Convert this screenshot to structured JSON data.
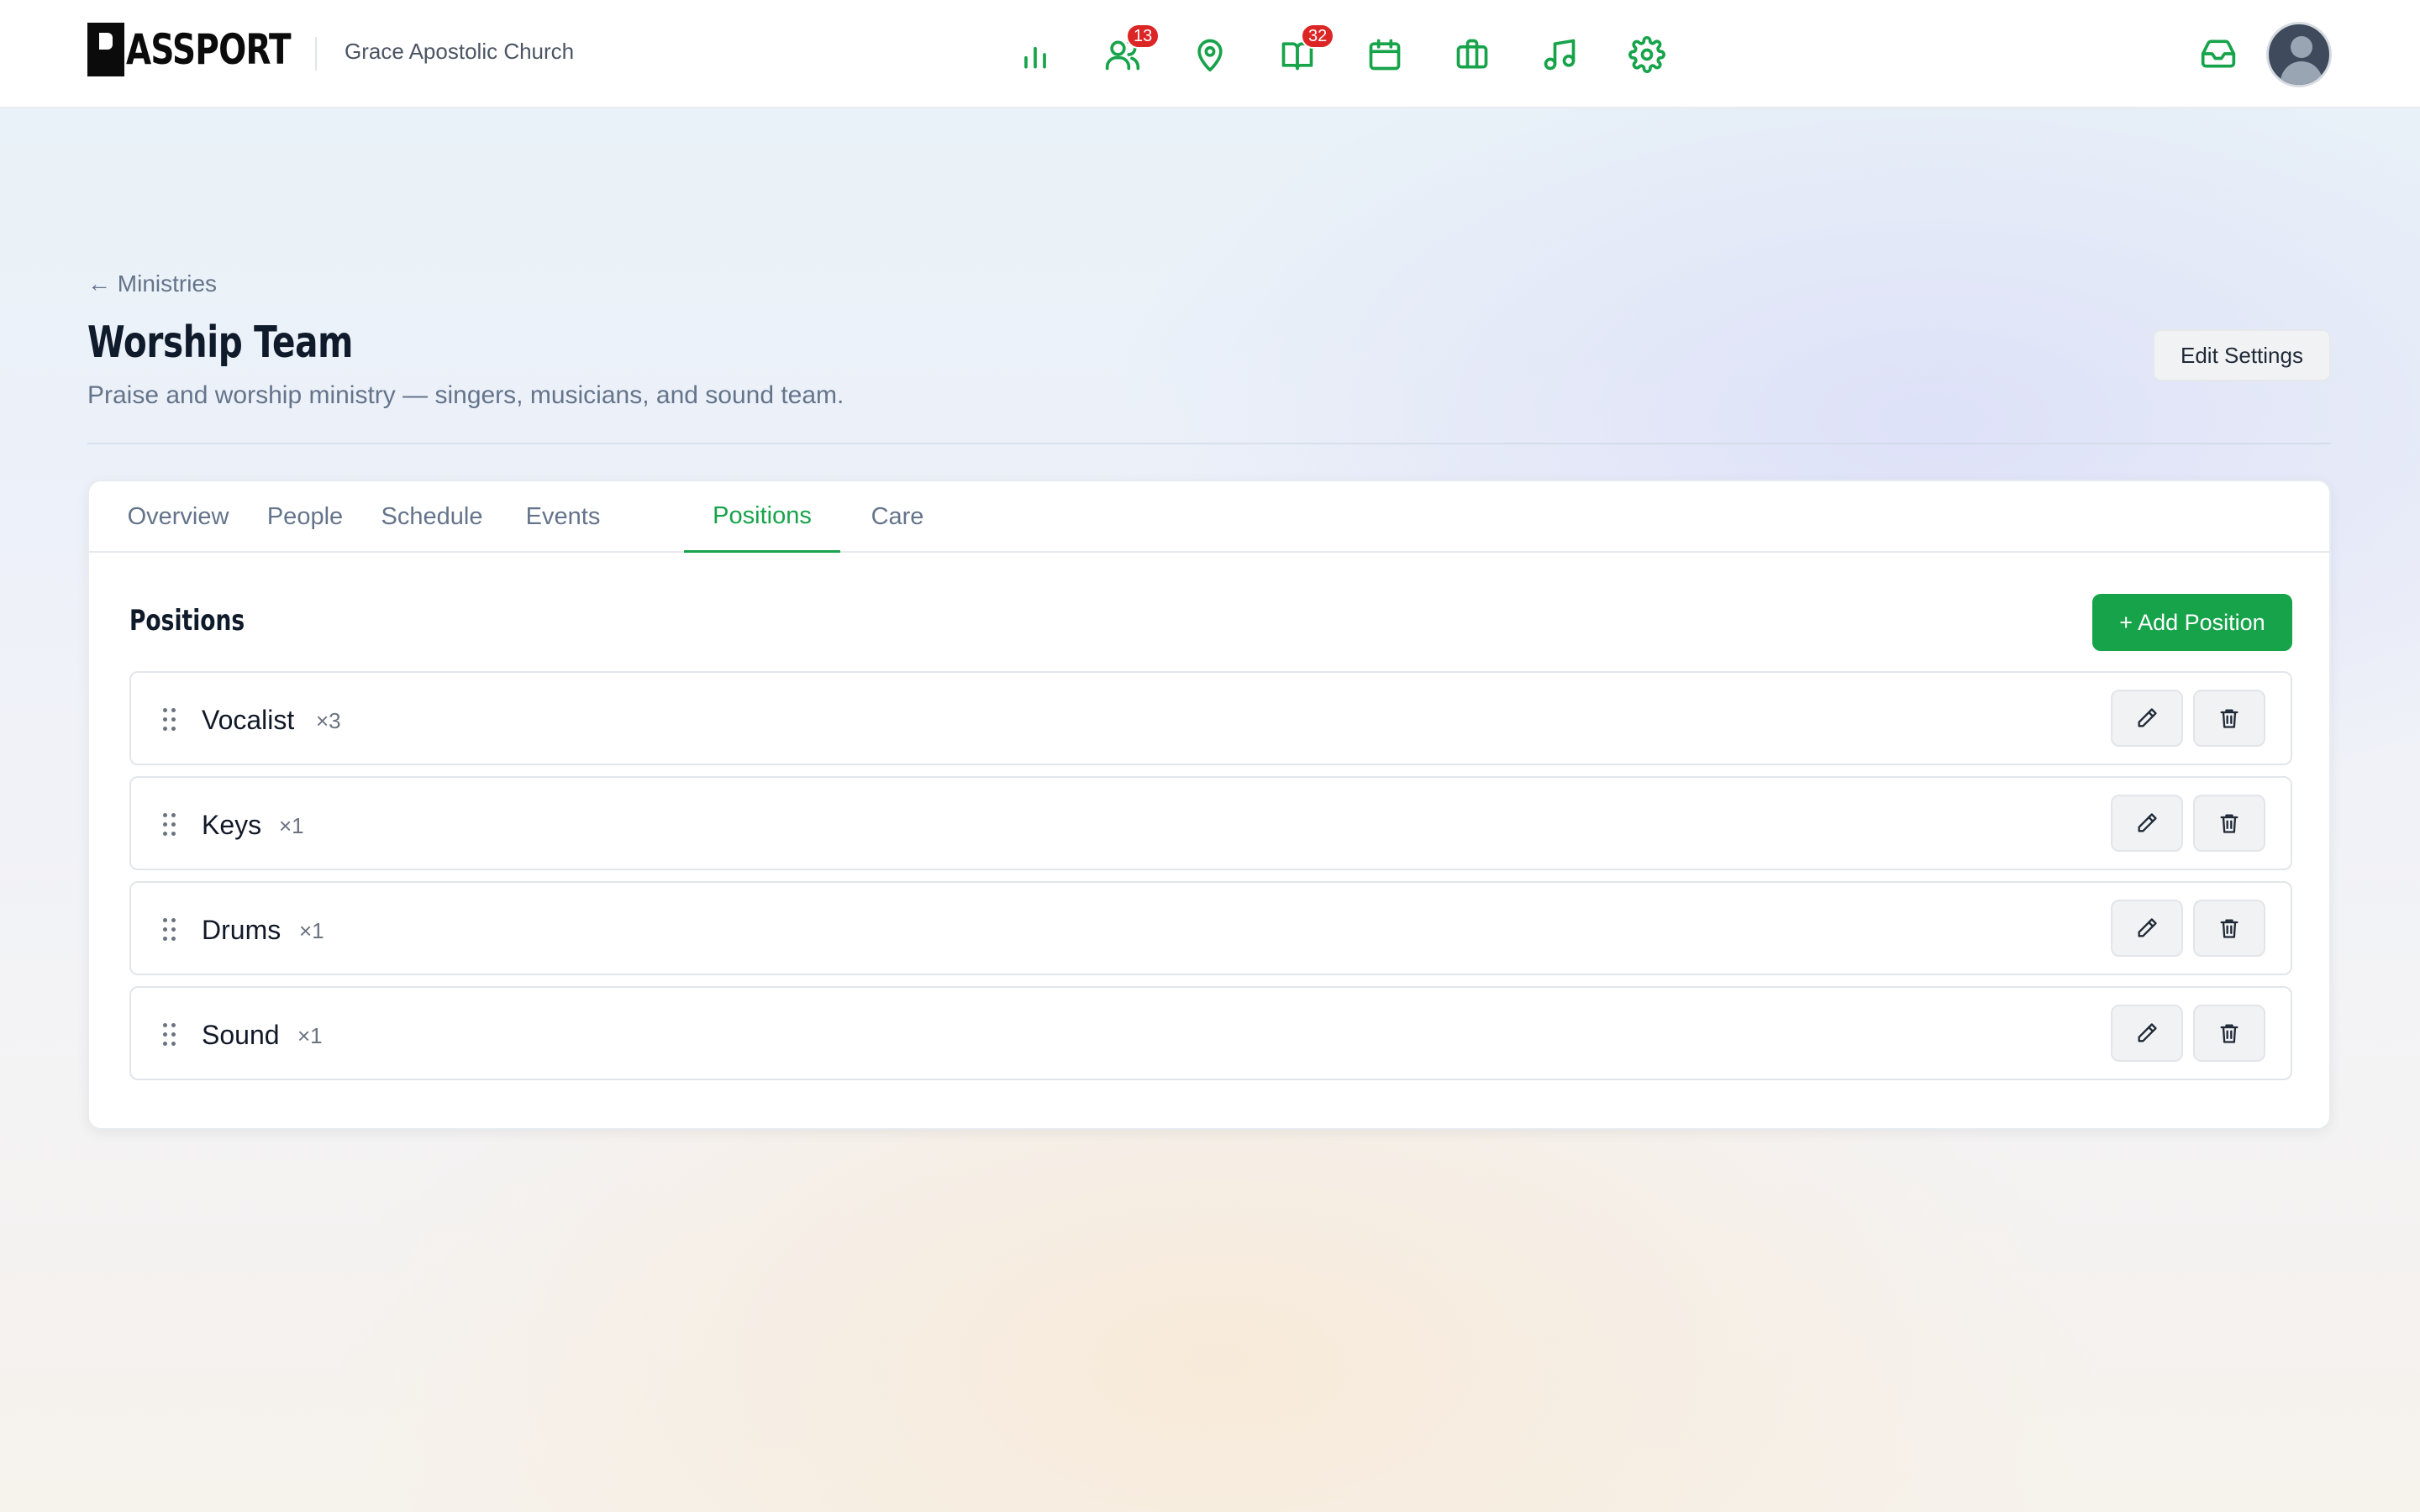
{
  "app": {
    "logo_text": "ASSPORT",
    "org_name": "Grace Apostolic Church"
  },
  "nav": [
    {
      "icon": "bar-chart-icon",
      "badge": null
    },
    {
      "icon": "users-icon",
      "badge": "13"
    },
    {
      "icon": "map-pin-icon",
      "badge": null
    },
    {
      "icon": "book-open-icon",
      "badge": "32"
    },
    {
      "icon": "calendar-icon",
      "badge": null
    },
    {
      "icon": "briefcase-icon",
      "badge": null
    },
    {
      "icon": "music-icon",
      "badge": null
    },
    {
      "icon": "settings-gear-icon",
      "badge": null
    }
  ],
  "header": {
    "back_link": "← Ministries",
    "title": "Worship Team",
    "description": "Praise and worship ministry — singers, musicians, and sound team.",
    "edit_button": "Edit Settings"
  },
  "tabs": [
    "Overview",
    "People",
    "Schedule",
    "Events",
    "Positions",
    "Care"
  ],
  "active_tab": "Positions",
  "positions": {
    "title": "Positions",
    "add_button": "+ Add Position",
    "items": [
      {
        "name": "Vocalist",
        "count": "×3"
      },
      {
        "name": "Keys",
        "count": "×1"
      },
      {
        "name": "Drums",
        "count": "×1"
      },
      {
        "name": "Sound",
        "count": "×1"
      }
    ]
  },
  "colors": {
    "accent": "#16a34a",
    "badge": "#dc2626",
    "text": "#111827",
    "muted": "#64748b"
  }
}
